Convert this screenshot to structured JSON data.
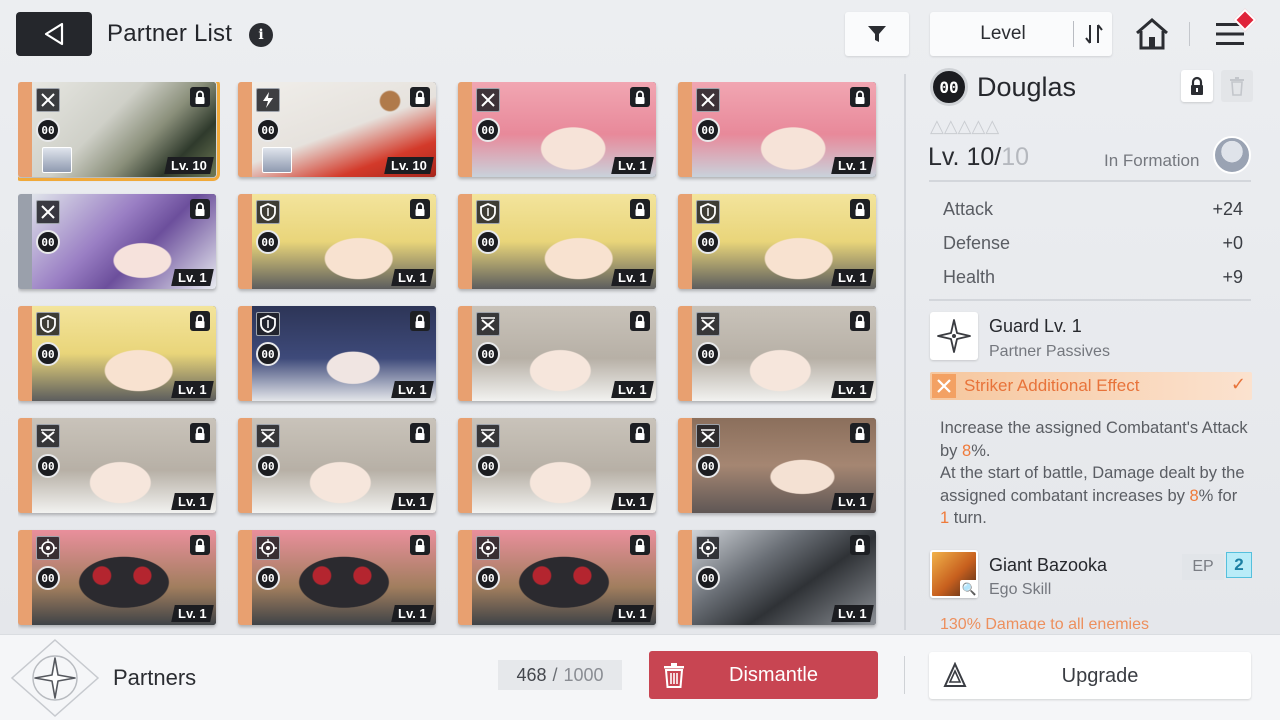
{
  "header": {
    "title": "Partner List",
    "info": "i",
    "sort_label": "Level"
  },
  "partners": [
    {
      "role": "striker",
      "rank": "00",
      "level": "Lv. 10",
      "art": "white-wolf",
      "selected": true,
      "avatar": true
    },
    {
      "role": "bolt",
      "rank": "00",
      "level": "Lv. 10",
      "art": "white-fox",
      "selected": false,
      "avatar": true
    },
    {
      "role": "striker",
      "rank": "00",
      "level": "Lv. 1",
      "art": "pink-hair",
      "selected": false,
      "avatar": false
    },
    {
      "role": "striker",
      "rank": "00",
      "level": "Lv. 1",
      "art": "pink-hair",
      "selected": false,
      "avatar": false
    },
    {
      "role": "striker",
      "rank": "00",
      "level": "Lv. 1",
      "art": "purple-winter",
      "selected": false,
      "avatar": false,
      "grey": true
    },
    {
      "role": "shield",
      "rank": "00",
      "level": "Lv. 1",
      "art": "blonde-headset",
      "selected": false,
      "avatar": false
    },
    {
      "role": "shield",
      "rank": "00",
      "level": "Lv. 1",
      "art": "blonde-headset",
      "selected": false,
      "avatar": false
    },
    {
      "role": "shield",
      "rank": "00",
      "level": "Lv. 1",
      "art": "blonde-headset",
      "selected": false,
      "avatar": false
    },
    {
      "role": "shield",
      "rank": "00",
      "level": "Lv. 1",
      "art": "blonde-headset",
      "selected": false,
      "avatar": false
    },
    {
      "role": "shield",
      "rank": "00",
      "level": "Lv. 1",
      "art": "navy-hair",
      "selected": false,
      "avatar": false
    },
    {
      "role": "cross",
      "rank": "00",
      "level": "Lv. 1",
      "art": "grey-braid",
      "selected": false,
      "avatar": false
    },
    {
      "role": "cross",
      "rank": "00",
      "level": "Lv. 1",
      "art": "grey-braid",
      "selected": false,
      "avatar": false
    },
    {
      "role": "cross",
      "rank": "00",
      "level": "Lv. 1",
      "art": "grey-braid",
      "selected": false,
      "avatar": false
    },
    {
      "role": "cross",
      "rank": "00",
      "level": "Lv. 1",
      "art": "grey-braid",
      "selected": false,
      "avatar": false
    },
    {
      "role": "cross",
      "rank": "00",
      "level": "Lv. 1",
      "art": "grey-braid",
      "selected": false,
      "avatar": false
    },
    {
      "role": "cross",
      "rank": "00",
      "level": "Lv. 1",
      "art": "brown-flower",
      "selected": false,
      "avatar": false
    },
    {
      "role": "target",
      "rank": "00",
      "level": "Lv. 1",
      "art": "black-cat",
      "selected": false,
      "avatar": false
    },
    {
      "role": "target",
      "rank": "00",
      "level": "Lv. 1",
      "art": "black-cat",
      "selected": false,
      "avatar": false
    },
    {
      "role": "target",
      "rank": "00",
      "level": "Lv. 1",
      "art": "black-cat",
      "selected": false,
      "avatar": false
    },
    {
      "role": "target",
      "rank": "00",
      "level": "Lv. 1",
      "art": "dark-mech",
      "selected": false,
      "avatar": false
    }
  ],
  "detail": {
    "rank": "00",
    "name": "Douglas",
    "stars": "△△△△△",
    "level_current": "Lv. 10/",
    "level_max": "10",
    "formation_label": "In Formation",
    "stats": [
      {
        "label": "Attack",
        "value": "+24"
      },
      {
        "label": "Defense",
        "value": "+0"
      },
      {
        "label": "Health",
        "value": "+9"
      }
    ],
    "passive": {
      "name": "Guard Lv. 1",
      "type": "Partner Passives"
    },
    "effect": {
      "label": "Striker Additional Effect",
      "check": "✓"
    },
    "description": {
      "p1": "Increase the assigned Combatant's Attack by ",
      "p1_val": "8",
      "p1_end": "%.",
      "p2": "At the start of battle, Damage dealt by the assigned combatant increases by ",
      "p2_val": "8",
      "p2_mid": "% for ",
      "p2_val2": "1",
      "p2_end": " turn."
    },
    "ego": {
      "name": "Giant Bazooka",
      "type": "Ego Skill",
      "ep_label": "EP",
      "ep_value": "2",
      "cut_text": "130% Damage to all enemies"
    }
  },
  "footer": {
    "label": "Partners",
    "count_current": "468",
    "count_sep": "/",
    "count_total": "1000",
    "dismantle_label": "Dismantle",
    "upgrade_label": "Upgrade"
  },
  "colors": {
    "accent_orange": "#ef7a3a",
    "dismantle_red": "#c84552",
    "ep_cyan": "#55c0dd",
    "selected_outline": "#f0a93a"
  }
}
